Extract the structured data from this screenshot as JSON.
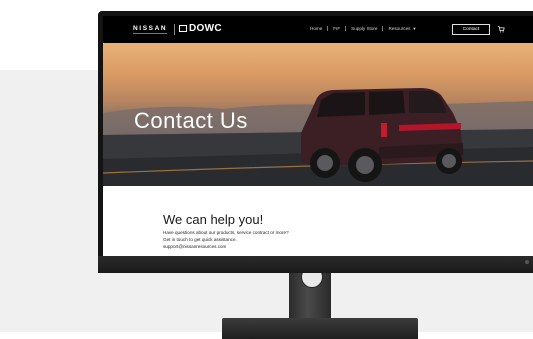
{
  "site": {
    "brand": "NISSAN",
    "partner": "DOWC"
  },
  "nav": {
    "items": [
      "Home",
      "FIF",
      "Supply Store",
      "Resources"
    ],
    "contact_label": "Contact"
  },
  "hero": {
    "title": "Contact Us"
  },
  "content": {
    "heading": "We can help you!",
    "lines": [
      "Have questions about our products, service contract or more?",
      "Get in touch to get quick assistance.",
      "support@nissanresources.com"
    ]
  },
  "icons": [
    "cart-icon",
    "chevron-down-icon"
  ]
}
